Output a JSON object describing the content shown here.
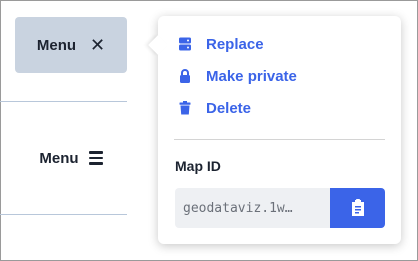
{
  "menu_open": {
    "label": "Menu",
    "icon": "close-icon"
  },
  "menu_closed": {
    "label": "Menu",
    "icon": "hamburger-icon"
  },
  "popover": {
    "items": [
      {
        "label": "Replace",
        "icon": "server-icon"
      },
      {
        "label": "Make private",
        "icon": "lock-icon"
      },
      {
        "label": "Delete",
        "icon": "trash-icon"
      }
    ],
    "map_id_label": "Map ID",
    "map_id_value": "geodataviz.1w…",
    "copy_icon": "clipboard-icon"
  },
  "colors": {
    "accent": "#3b64e8",
    "menu_button_bg": "#c9d3e0",
    "text": "#1c2330"
  }
}
